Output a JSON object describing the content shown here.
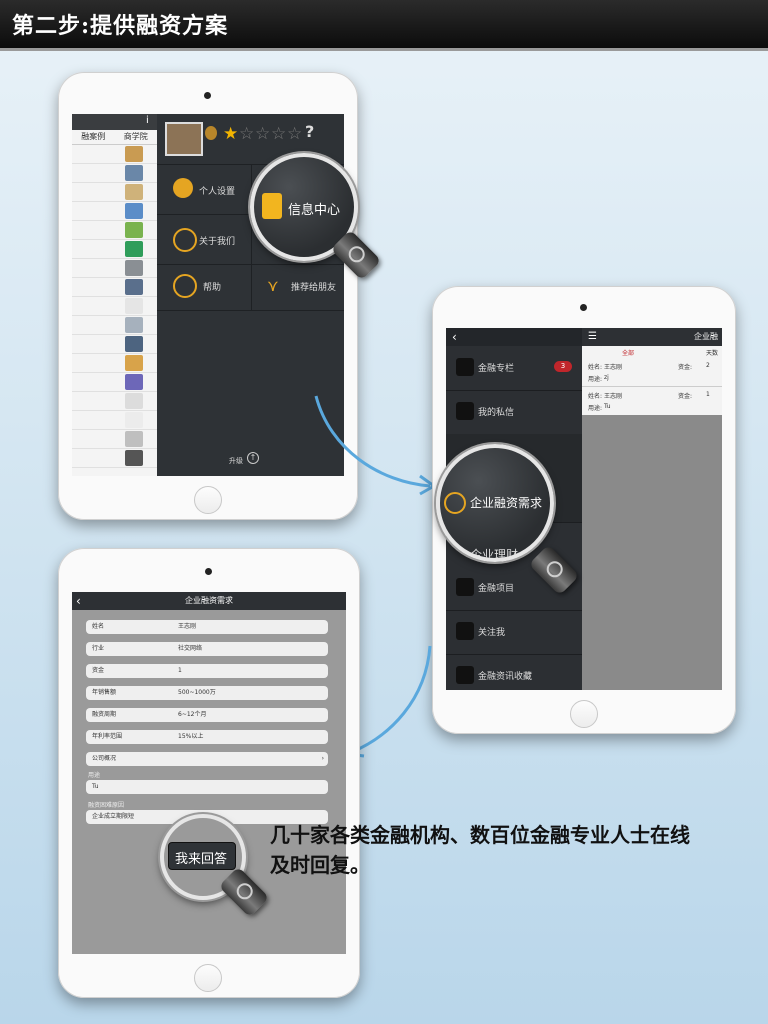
{
  "header": {
    "title": "第二步:提供融资方案"
  },
  "ipad1": {
    "tabs": [
      "融案例",
      "商学院"
    ],
    "info_glyph": "i",
    "rating": {
      "stars_filled": 1,
      "stars_total": 5
    },
    "help_q": "?",
    "menu": {
      "personal_settings": "个人设置",
      "info_center": "信息中心",
      "about_us": "关于我们",
      "help": "帮助",
      "recommend": "推荐给朋友",
      "upgrade": "升级"
    },
    "magnifier_label": "信息中心"
  },
  "ipad2": {
    "back_glyph": "‹",
    "right_title": "企业融",
    "menu_items": [
      {
        "label": "金融专栏",
        "badge": "3"
      },
      {
        "label": "我的私信"
      },
      {
        "label": "企业融资需求"
      },
      {
        "label": "企业理财"
      },
      {
        "label": "金融项目"
      },
      {
        "label": "关注我"
      },
      {
        "label": "金融资讯收藏"
      }
    ],
    "magnifier_label": "企业融资需求",
    "cards": [
      {
        "name_key": "姓名:",
        "name": "王志刚",
        "funds_key": "资金:",
        "funds": "2",
        "use_key": "用途:",
        "use": "zj"
      },
      {
        "name_key": "姓名:",
        "name": "王志刚",
        "funds_key": "资金:",
        "funds": "1",
        "use_key": "用途:",
        "use": "Tu"
      }
    ],
    "tab_all": "全部",
    "tab_right": "天数"
  },
  "ipad3": {
    "title": "企业融资需求",
    "fields": [
      {
        "key": "姓名",
        "value": "王志刚"
      },
      {
        "key": "行业",
        "value": "社交网络"
      },
      {
        "key": "资金",
        "value": "1"
      },
      {
        "key": "年销售额",
        "value": "500~1000万"
      },
      {
        "key": "融资周期",
        "value": "6~12个月"
      },
      {
        "key": "年利率范围",
        "value": "15%以上"
      },
      {
        "key": "公司概况",
        "value": ""
      }
    ],
    "use_label": "用途",
    "use_value": "Tu",
    "reply_label": "融资困难原因",
    "reply_item": "企业成立期限短",
    "magnifier_label": "我来回答"
  },
  "caption": "几十家各类金融机构、数百位金融专业人士在线及时回复。",
  "colors": {
    "accent_arrow": "#5aa8dd",
    "badge_red": "#c0262b",
    "star": "#f2b400"
  }
}
